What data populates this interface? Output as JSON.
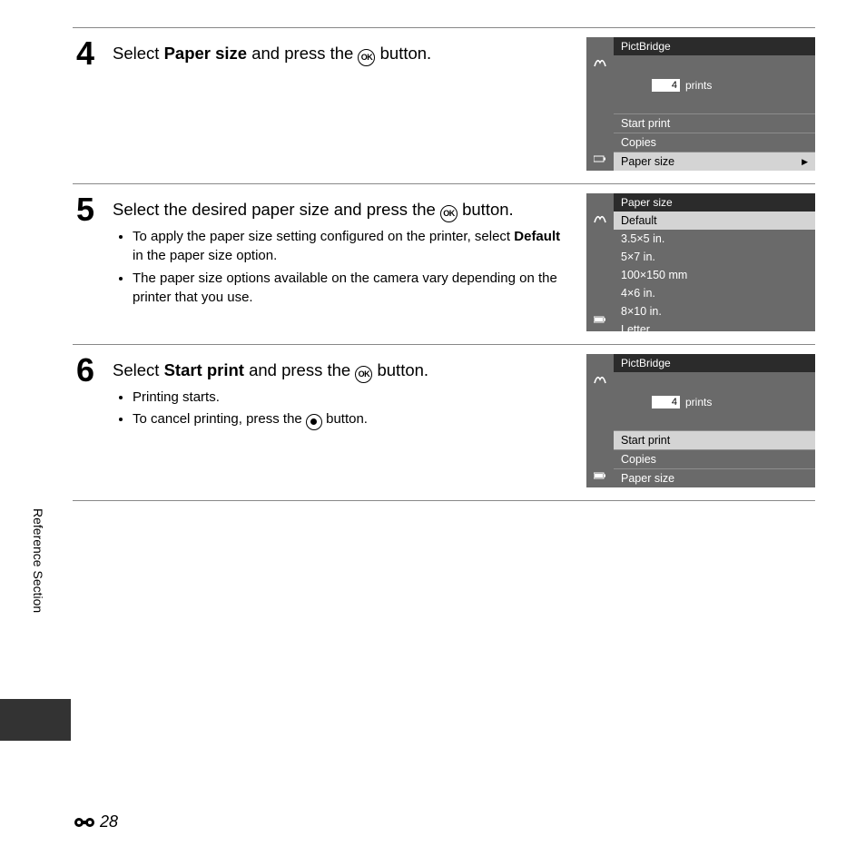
{
  "sidebar_label": "Reference Section",
  "page_number": "28",
  "steps": {
    "s4": {
      "num": "4",
      "heading_pre": "Select ",
      "heading_bold": "Paper size",
      "heading_mid": " and press the ",
      "heading_ok": "OK",
      "heading_post": " button."
    },
    "s5": {
      "num": "5",
      "heading_pre": "Select the desired paper size and press the ",
      "heading_ok": "OK",
      "heading_post": " button.",
      "b1_pre": "To apply the paper size setting configured on the printer, select ",
      "b1_bold": "Default",
      "b1_post": " in the paper size option.",
      "b2": "The paper size options available on the camera vary depending on the printer that you use."
    },
    "s6": {
      "num": "6",
      "heading_pre": "Select ",
      "heading_bold": "Start print",
      "heading_mid": " and press the ",
      "heading_ok": "OK",
      "heading_post": " button.",
      "b1": "Printing starts.",
      "b2_pre": "To cancel printing, press the ",
      "b2_post": " button."
    }
  },
  "screen1": {
    "title": "PictBridge",
    "prints_count": "4",
    "prints_label": "prints",
    "menu": [
      "Start print",
      "Copies",
      "Paper size"
    ],
    "selected_index": 2
  },
  "screen2": {
    "title": "Paper size",
    "options": [
      "Default",
      "3.5×5 in.",
      "5×7 in.",
      "100×150 mm",
      "4×6 in.",
      "8×10 in.",
      "Letter"
    ],
    "selected_index": 0
  },
  "screen3": {
    "title": "PictBridge",
    "prints_count": "4",
    "prints_label": "prints",
    "menu": [
      "Start print",
      "Copies",
      "Paper size"
    ],
    "selected_index": 0
  }
}
